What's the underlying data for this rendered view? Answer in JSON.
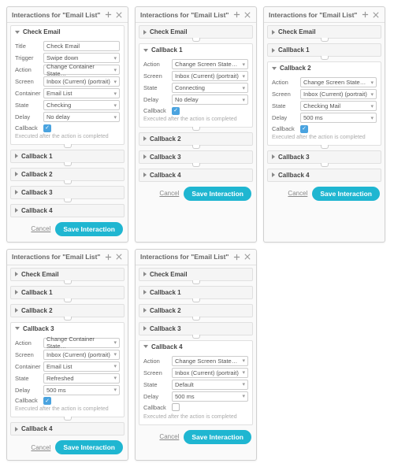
{
  "common": {
    "panel_title": "Interactions for \"Email List\"",
    "labels": {
      "title": "Title",
      "trigger": "Trigger",
      "action": "Action",
      "screen": "Screen",
      "container": "Container",
      "state": "State",
      "delay": "Delay",
      "callback": "Callback"
    },
    "hint": "Executed after the action is completed",
    "cancel": "Cancel",
    "save": "Save Interaction"
  },
  "panels": [
    {
      "sections": [
        {
          "name": "Check Email",
          "open": true,
          "rows": [
            {
              "k": "title",
              "label": "Title",
              "type": "text",
              "value": "Check Email"
            },
            {
              "k": "trigger",
              "label": "Trigger",
              "type": "select",
              "value": "Swipe down"
            },
            {
              "k": "action",
              "label": "Action",
              "type": "select",
              "value": "Change Container State…"
            },
            {
              "k": "screen",
              "label": "Screen",
              "type": "select",
              "value": "Inbox (Current) (portrait)"
            },
            {
              "k": "container",
              "label": "Container",
              "type": "select",
              "value": "Email List"
            },
            {
              "k": "state",
              "label": "State",
              "type": "select",
              "value": "Checking"
            },
            {
              "k": "delay",
              "label": "Delay",
              "type": "select",
              "value": "No delay"
            },
            {
              "k": "callback",
              "label": "Callback",
              "type": "check",
              "value": true,
              "hint": true
            }
          ]
        },
        {
          "name": "Callback 1",
          "open": false
        },
        {
          "name": "Callback 2",
          "open": false
        },
        {
          "name": "Callback 3",
          "open": false
        },
        {
          "name": "Callback 4",
          "open": false
        }
      ]
    },
    {
      "sections": [
        {
          "name": "Check Email",
          "open": false
        },
        {
          "name": "Callback 1",
          "open": true,
          "rows": [
            {
              "k": "action",
              "label": "Action",
              "type": "select",
              "value": "Change Screen State…"
            },
            {
              "k": "screen",
              "label": "Screen",
              "type": "select",
              "value": "Inbox (Current) (portrait)"
            },
            {
              "k": "state",
              "label": "State",
              "type": "select",
              "value": "Connecting"
            },
            {
              "k": "delay",
              "label": "Delay",
              "type": "select",
              "value": "No delay"
            },
            {
              "k": "callback",
              "label": "Callback",
              "type": "check",
              "value": true,
              "hint": true
            }
          ]
        },
        {
          "name": "Callback 2",
          "open": false
        },
        {
          "name": "Callback 3",
          "open": false
        },
        {
          "name": "Callback 4",
          "open": false
        }
      ]
    },
    {
      "sections": [
        {
          "name": "Check Email",
          "open": false
        },
        {
          "name": "Callback 1",
          "open": false
        },
        {
          "name": "Callback 2",
          "open": true,
          "rows": [
            {
              "k": "action",
              "label": "Action",
              "type": "select",
              "value": "Change Screen State…"
            },
            {
              "k": "screen",
              "label": "Screen",
              "type": "select",
              "value": "Inbox (Current) (portrait)"
            },
            {
              "k": "state",
              "label": "State",
              "type": "select",
              "value": "Checking Mail"
            },
            {
              "k": "delay",
              "label": "Delay",
              "type": "select",
              "value": "500 ms"
            },
            {
              "k": "callback",
              "label": "Callback",
              "type": "check",
              "value": true,
              "hint": true
            }
          ]
        },
        {
          "name": "Callback 3",
          "open": false
        },
        {
          "name": "Callback 4",
          "open": false
        }
      ]
    },
    {
      "sections": [
        {
          "name": "Check Email",
          "open": false
        },
        {
          "name": "Callback 1",
          "open": false
        },
        {
          "name": "Callback 2",
          "open": false
        },
        {
          "name": "Callback 3",
          "open": true,
          "rows": [
            {
              "k": "action",
              "label": "Action",
              "type": "select",
              "value": "Change Container State…"
            },
            {
              "k": "screen",
              "label": "Screen",
              "type": "select",
              "value": "Inbox (Current) (portrait)"
            },
            {
              "k": "container",
              "label": "Container",
              "type": "select",
              "value": "Email List"
            },
            {
              "k": "state",
              "label": "State",
              "type": "select",
              "value": "Refreshed"
            },
            {
              "k": "delay",
              "label": "Delay",
              "type": "select",
              "value": "500 ms"
            },
            {
              "k": "callback",
              "label": "Callback",
              "type": "check",
              "value": true,
              "hint": true
            }
          ]
        },
        {
          "name": "Callback 4",
          "open": false
        }
      ]
    },
    {
      "sections": [
        {
          "name": "Check Email",
          "open": false
        },
        {
          "name": "Callback 1",
          "open": false
        },
        {
          "name": "Callback 2",
          "open": false
        },
        {
          "name": "Callback 3",
          "open": false
        },
        {
          "name": "Callback 4",
          "open": true,
          "rows": [
            {
              "k": "action",
              "label": "Action",
              "type": "select",
              "value": "Change Screen State…"
            },
            {
              "k": "screen",
              "label": "Screen",
              "type": "select",
              "value": "Inbox (Current) (portrait)"
            },
            {
              "k": "state",
              "label": "State",
              "type": "select",
              "value": "Default"
            },
            {
              "k": "delay",
              "label": "Delay",
              "type": "select",
              "value": "500 ms"
            },
            {
              "k": "callback",
              "label": "Callback",
              "type": "check",
              "value": false,
              "hint": true
            }
          ]
        }
      ]
    }
  ]
}
